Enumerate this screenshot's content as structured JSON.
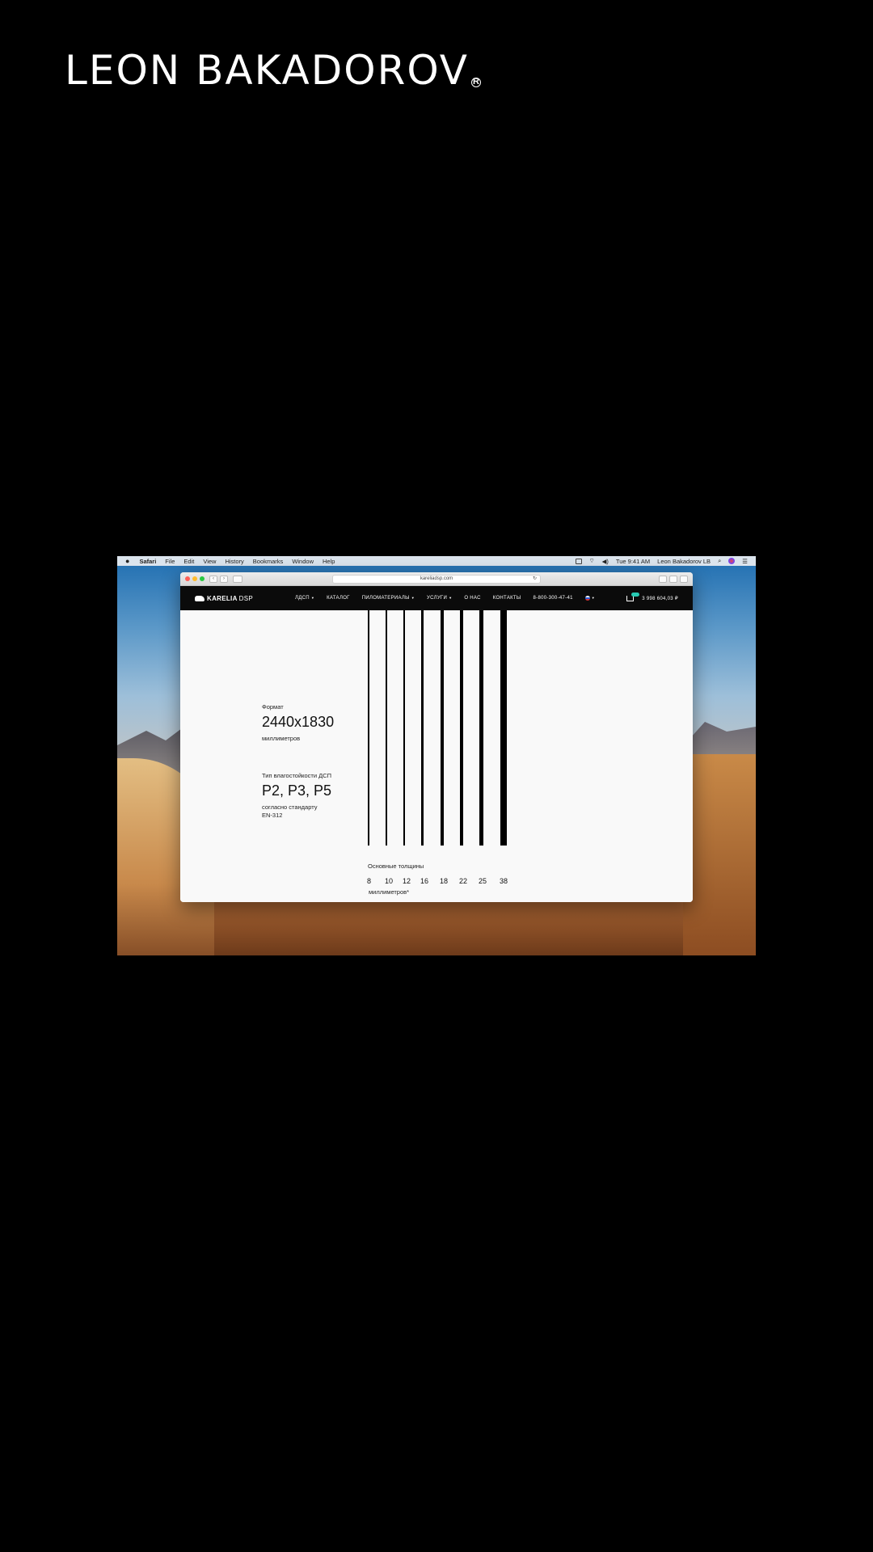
{
  "brand": {
    "name": "LEON BAKADOROV",
    "mark": "R"
  },
  "menubar": {
    "apple": "",
    "items": [
      "Safari",
      "File",
      "Edit",
      "View",
      "History",
      "Bookmarks",
      "Window",
      "Help"
    ],
    "clock": "Tue 9:41 AM",
    "user": "Leon Bakadorov LB"
  },
  "browser": {
    "url": "kareliadsp.com",
    "nav_back": "‹",
    "nav_forward": "›"
  },
  "site": {
    "logo": {
      "bold": "KARELIA",
      "thin": "DSP"
    },
    "nav": [
      "ЛДСП",
      "КАТАЛОГ",
      "ПИЛОМАТЕРИАЛЫ",
      "УСЛУГИ",
      "О НАС",
      "КОНТАКТЫ",
      "8-800-300-47-41"
    ],
    "cart_total": "3 998 604,03 ₽"
  },
  "content": {
    "format_label": "Формат",
    "format_value": "2440x1830",
    "format_unit": "миллиметров",
    "moisture_label": "Тип влагостойкости ДСП",
    "moisture_value": "P2, P3, P5",
    "moisture_note_1": "согласно стандарту",
    "moisture_note_2": "EN-312",
    "thickness_label": "Основные толщины",
    "thickness_unit": "миллиметров*",
    "thicknesses": [
      "8",
      "10",
      "12",
      "16",
      "18",
      "22",
      "25",
      "38"
    ]
  },
  "colors": {
    "page_bg": "#000000",
    "site_nav_bg": "#0b0b0b",
    "cart_badge": "#27c9b2"
  }
}
